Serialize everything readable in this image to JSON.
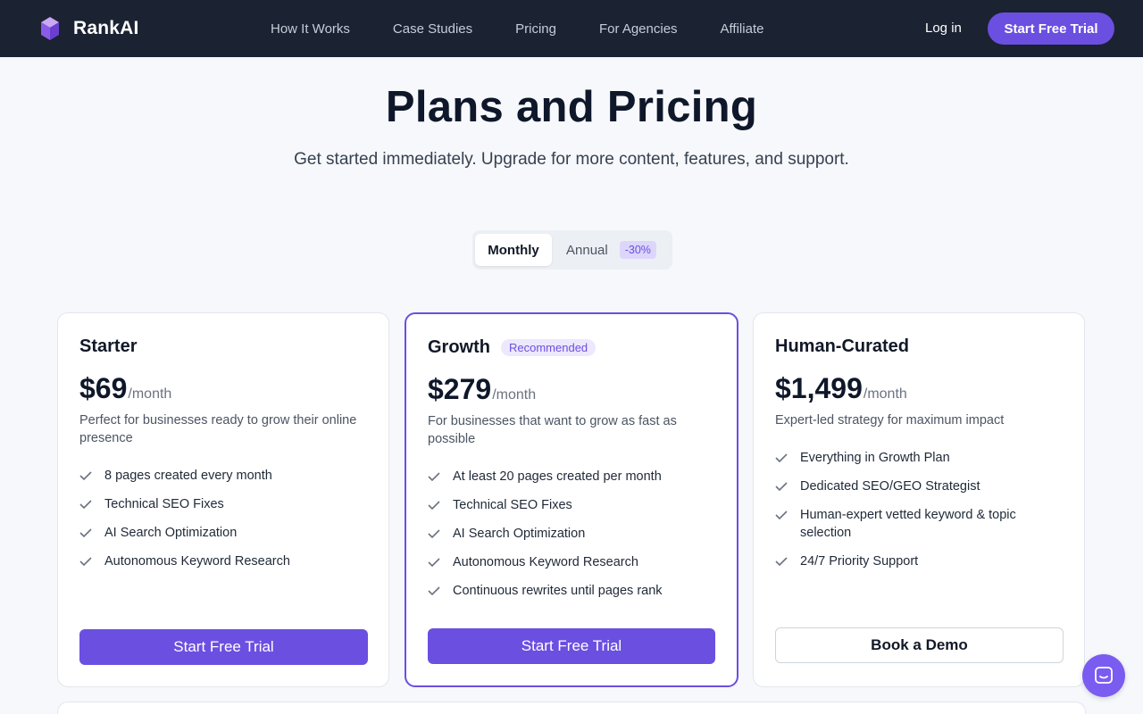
{
  "header": {
    "brand": "RankAI",
    "nav": [
      "How It Works",
      "Case Studies",
      "Pricing",
      "For Agencies",
      "Affiliate"
    ],
    "login": "Log in",
    "cta": "Start Free Trial"
  },
  "hero": {
    "title": "Plans and Pricing",
    "subtitle": "Get started immediately. Upgrade for more content, features, and support."
  },
  "billing_toggle": {
    "monthly": "Monthly",
    "annual": "Annual",
    "annual_discount": "-30%",
    "selected": "Monthly"
  },
  "plans": [
    {
      "name": "Starter",
      "badge": "",
      "price": "$69",
      "period": "/month",
      "description": "Perfect for businesses ready to grow their online presence",
      "features": [
        "8 pages created every month",
        "Technical SEO Fixes",
        "AI Search Optimization",
        "Autonomous Keyword Research"
      ],
      "button": "Start Free Trial"
    },
    {
      "name": "Growth",
      "badge": "Recommended",
      "price": "$279",
      "period": "/month",
      "description": "For businesses that want to grow as fast as possible",
      "features": [
        "At least 20 pages created per month",
        "Technical SEO Fixes",
        "AI Search Optimization",
        "Autonomous Keyword Research",
        "Continuous rewrites until pages rank"
      ],
      "button": "Start Free Trial"
    },
    {
      "name": "Human-Curated",
      "badge": "",
      "price": "$1,499",
      "period": "/month",
      "description": "Expert-led strategy for maximum impact",
      "features": [
        "Everything in Growth Plan",
        "Dedicated SEO/GEO Strategist",
        "Human-expert vetted keyword & topic selection",
        "24/7 Priority Support"
      ],
      "button": "Book a Demo"
    }
  ],
  "icons": {
    "logo": "rankai-logo-icon",
    "check": "check-icon",
    "chat": "chat-icon"
  },
  "colors": {
    "accent": "#6b4fe0",
    "header_bg": "#1b2232",
    "page_bg": "#f6f8fb"
  }
}
